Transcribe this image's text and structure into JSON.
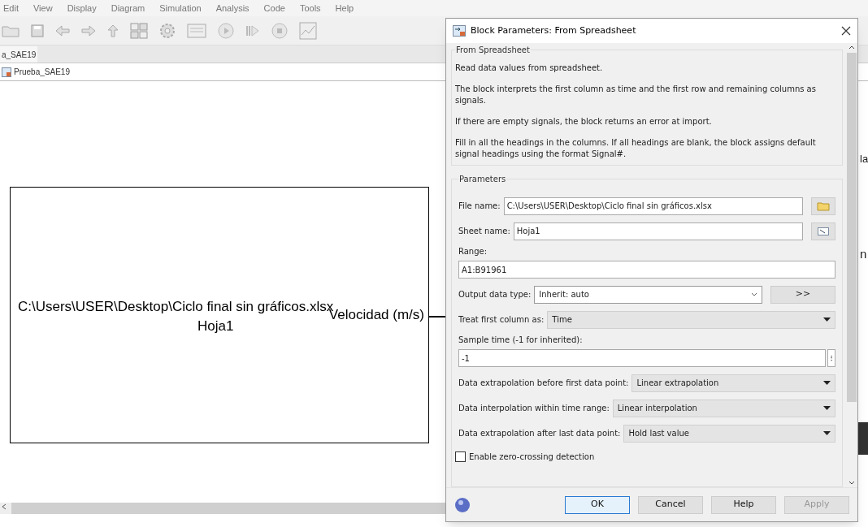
{
  "menu": [
    "Edit",
    "View",
    "Display",
    "Diagram",
    "Simulation",
    "Analysis",
    "Code",
    "Tools",
    "Help"
  ],
  "tab": "a_SAE19",
  "breadcrumb": "Prueba_SAE19",
  "block": {
    "lines": [
      "C:\\Users\\USER\\Desktop\\Ciclo final sin gráficos.xlsx",
      "Hoja1"
    ],
    "port_label": "Velocidad (m/s)"
  },
  "behind_texts": [
    "la",
    "n"
  ],
  "dialog": {
    "title": "Block Parameters: From Spreadsheet",
    "section": "From Spreadsheet",
    "description": [
      "Read data values from spreadsheet.",
      "The block interprets the first column as time and the first row and remaining columns as signals.",
      "If there are empty signals, the block returns an error at import.",
      "Fill in all the headings in the columns. If all headings are blank, the block assigns default signal headings using the format Signal#."
    ],
    "group": "Parameters",
    "fields": [
      {
        "kind": "file",
        "label": "File name:",
        "value": "C:\\Users\\USER\\Desktop\\Ciclo final sin gráficos.xlsx"
      },
      {
        "kind": "sheet",
        "label": "Sheet name:",
        "value": "Hoja1"
      },
      {
        "kind": "stacked",
        "label": "Range:",
        "value": "A1:B91961"
      },
      {
        "kind": "combo",
        "label": "Output data type:",
        "value": "Inherit: auto",
        "button": ">>"
      },
      {
        "kind": "select",
        "label": "Treat first column as:",
        "value": "Time"
      },
      {
        "kind": "stacked",
        "label": "Sample time (-1 for inherited):",
        "value": "-1",
        "menu": "⁝"
      },
      {
        "kind": "select",
        "label": "Data extrapolation before first data point:",
        "value": "Linear extrapolation"
      },
      {
        "kind": "select",
        "label": "Data interpolation within time range:",
        "value": "Linear interpolation"
      },
      {
        "kind": "select",
        "label": "Data extrapolation after last data point:",
        "value": "Hold last value"
      },
      {
        "kind": "checkbox",
        "label": "Enable zero-crossing detection",
        "checked": false
      }
    ],
    "buttons": [
      {
        "label": "OK",
        "default": true,
        "disabled": false
      },
      {
        "label": "Cancel",
        "default": false,
        "disabled": false
      },
      {
        "label": "Help",
        "default": false,
        "disabled": false
      },
      {
        "label": "Apply",
        "default": false,
        "disabled": true
      }
    ]
  }
}
